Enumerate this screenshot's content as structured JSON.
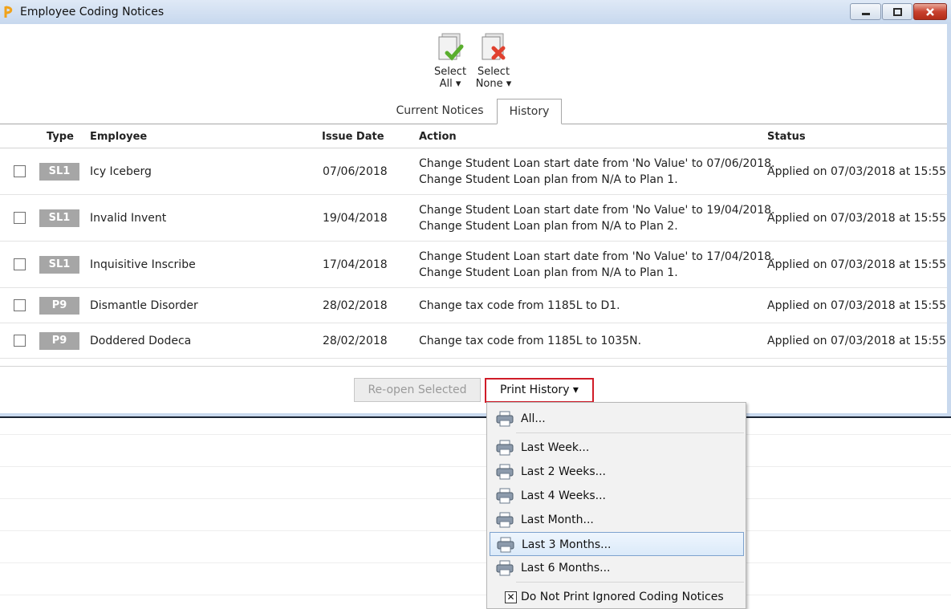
{
  "window": {
    "title": "Employee Coding Notices"
  },
  "toolbar": {
    "select_all": {
      "line1": "Select",
      "line2": "All ▾"
    },
    "select_none": {
      "line1": "Select",
      "line2": "None ▾"
    }
  },
  "tabs": [
    {
      "label": "Current Notices",
      "active": false
    },
    {
      "label": "History",
      "active": true
    }
  ],
  "grid": {
    "columns": [
      "Type",
      "Employee",
      "Issue Date",
      "Action",
      "Status"
    ],
    "rows": [
      {
        "type": "SL1",
        "employee": "Icy Iceberg",
        "issue_date": "07/06/2018",
        "action_1": "Change Student Loan start date from 'No Value' to 07/06/2018.",
        "action_2": "Change Student Loan plan from N/A to Plan 1.",
        "status": "Applied on 07/03/2018 at 15:55",
        "checked": false
      },
      {
        "type": "SL1",
        "employee": "Invalid Invent",
        "issue_date": "19/04/2018",
        "action_1": "Change Student Loan start date from 'No Value' to 19/04/2018.",
        "action_2": "Change Student Loan plan from N/A to Plan 2.",
        "status": "Applied on 07/03/2018 at 15:55",
        "checked": false
      },
      {
        "type": "SL1",
        "employee": "Inquisitive Inscribe",
        "issue_date": "17/04/2018",
        "action_1": "Change Student Loan start date from 'No Value' to 17/04/2018.",
        "action_2": "Change Student Loan plan from N/A to Plan 1.",
        "status": "Applied on 07/03/2018 at 15:55",
        "checked": false
      },
      {
        "type": "P9",
        "employee": "Dismantle Disorder",
        "issue_date": "28/02/2018",
        "action_1": "Change tax code from 1185L to D1.",
        "action_2": "",
        "status": "Applied on 07/03/2018 at 15:55",
        "checked": false
      },
      {
        "type": "P9",
        "employee": "Doddered Dodeca",
        "issue_date": "28/02/2018",
        "action_1": "Change tax code from 1185L to 1035N.",
        "action_2": "",
        "status": "Applied on 07/03/2018 at 15:55",
        "checked": false
      }
    ]
  },
  "buttons": {
    "reopen": "Re-open Selected",
    "print_history": "Print History ▾"
  },
  "print_menu": {
    "items": [
      "All...",
      "Last Week...",
      "Last 2 Weeks...",
      "Last 4 Weeks...",
      "Last Month...",
      "Last 3 Months...",
      "Last 6 Months..."
    ],
    "highlighted": "Last 3 Months...",
    "option_do_not_print": "Do Not Print Ignored Coding Notices",
    "option_do_not_print_checked": true
  },
  "colors": {
    "frame": "#c9d9ee",
    "type_badge": "#a6a6a6",
    "print_button_border": "#d01c28",
    "menu_highlight": "#dbeaf9"
  }
}
